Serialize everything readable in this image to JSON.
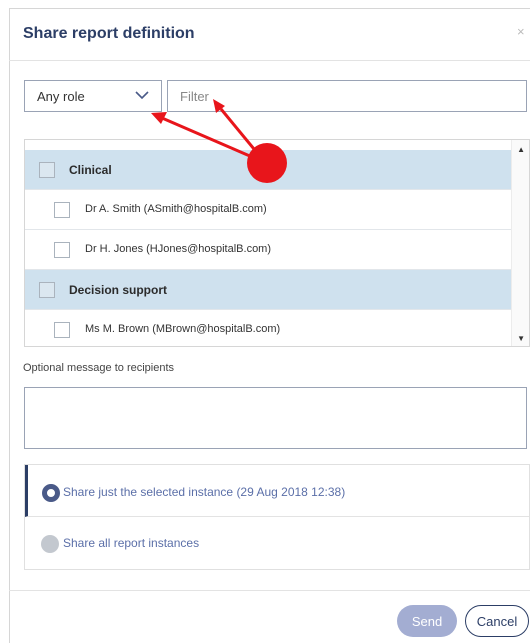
{
  "dialog": {
    "title": "Share report definition",
    "close_glyph": "×"
  },
  "filters": {
    "role_value": "Any role",
    "filter_placeholder": "Filter"
  },
  "recipients": {
    "groups": [
      {
        "name": "Clinical",
        "members": [
          "Dr A. Smith (ASmith@hospitalB.com)",
          "Dr H. Jones (HJones@hospitalB.com)"
        ]
      },
      {
        "name": "Decision support",
        "members": [
          "Ms M. Brown (MBrown@hospitalB.com)"
        ]
      }
    ]
  },
  "message": {
    "label": "Optional message to recipients",
    "value": ""
  },
  "share_options": [
    {
      "label": "Share just the selected instance (29 Aug 2018 12:38)",
      "selected": true
    },
    {
      "label": "Share all report instances",
      "selected": false
    }
  ],
  "buttons": {
    "send": "Send",
    "cancel": "Cancel"
  },
  "colors": {
    "title": "#2c3e66",
    "group_row": "#cfe1ee",
    "option_text": "#5b6fa8",
    "send_button": "#a3add2",
    "annotation": "#e8151b"
  }
}
